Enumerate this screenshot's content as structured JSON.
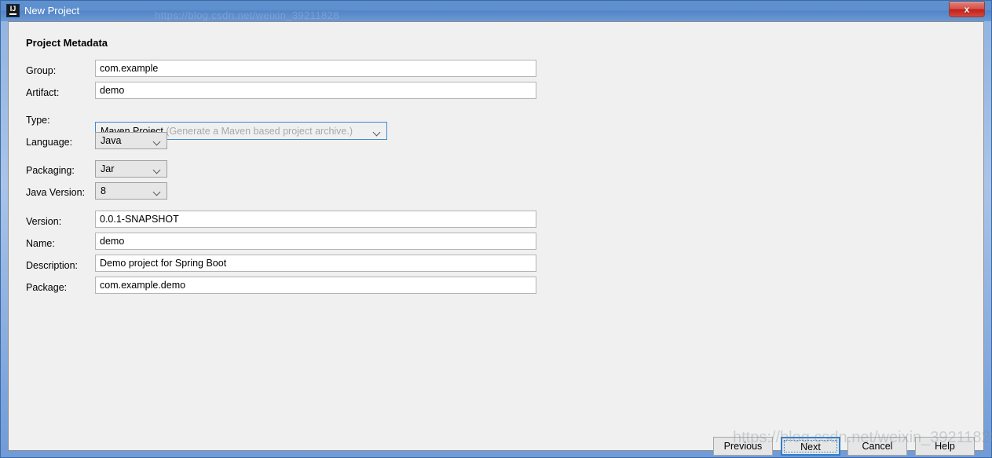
{
  "window": {
    "title": "New Project",
    "icon": "intellij-idea-icon",
    "close_label": "x",
    "title_watermark": "https://blog.csdn.net/weixin_39211828"
  },
  "section": {
    "heading": "Project Metadata"
  },
  "fields": {
    "group": {
      "label": "Group:",
      "value": "com.example"
    },
    "artifact": {
      "label": "Artifact:",
      "value": "demo"
    },
    "type": {
      "label": "Type:",
      "value": "Maven Project",
      "hint": "(Generate a Maven based project archive.)"
    },
    "language": {
      "label": "Language:",
      "value": "Java"
    },
    "packaging": {
      "label": "Packaging:",
      "value": "Jar"
    },
    "java_version": {
      "label": "Java Version:",
      "value": "8"
    },
    "version": {
      "label": "Version:",
      "value": "0.0.1-SNAPSHOT"
    },
    "name": {
      "label": "Name:",
      "value": "demo"
    },
    "description": {
      "label": "Description:",
      "value": "Demo project for Spring Boot"
    },
    "package": {
      "label": "Package:",
      "value": "com.example.demo"
    }
  },
  "buttons": {
    "previous": "Previous",
    "next": "Next",
    "cancel": "Cancel",
    "help": "Help"
  },
  "watermark": "https://blog.csdn.net/weixin_39211828",
  "colors": {
    "titlebar_blue": "#5e8fce",
    "focus_blue": "#2c7fd0",
    "panel_gray": "#f0f0f0",
    "close_red": "#bc231c"
  }
}
